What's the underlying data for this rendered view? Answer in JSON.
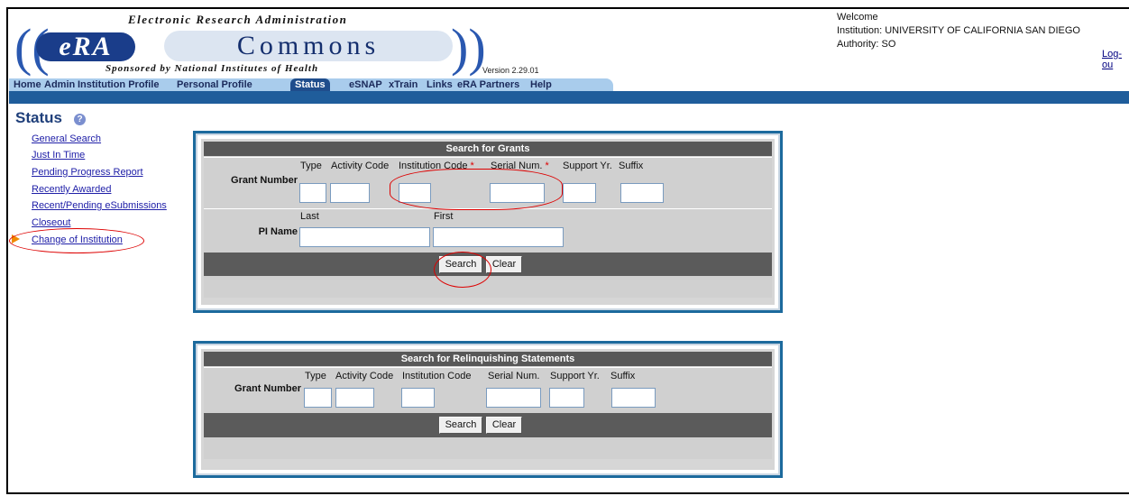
{
  "logo": {
    "top_text": "Electronic Research Administration",
    "era": "eRA",
    "commons": "Commons",
    "bottom_text": "Sponsored by National Institutes of Health"
  },
  "version": "Version 2.29.01",
  "welcome": {
    "line1": "Welcome",
    "institution": "Institution: UNIVERSITY OF CALIFORNIA SAN DIEGO",
    "authority": "Authority:  SO",
    "logout": "Log-ou"
  },
  "nav": {
    "items": [
      "Home",
      "Admin",
      "Institution Profile",
      "Personal Profile",
      "Status",
      "eSNAP",
      "xTrain",
      "Links",
      "eRA Partners",
      "Help"
    ],
    "active": "Status"
  },
  "page_title": "Status",
  "sidebar": {
    "links": [
      "General Search",
      "Just In Time",
      "Pending Progress Report",
      "Recently Awarded",
      "Recent/Pending eSubmissions",
      "Closeout",
      "Change of Institution"
    ]
  },
  "grants_panel": {
    "title": "Search for Grants",
    "grant_number_label": "Grant Number",
    "fields": [
      "Type",
      "Activity Code",
      "Institution Code",
      "Serial Num.",
      "Support Yr.",
      "Suffix"
    ],
    "pi_label": "PI Name",
    "last_label": "Last",
    "first_label": "First",
    "search_button": "Search",
    "clear_button": "Clear"
  },
  "relinquish_panel": {
    "title": "Search for Relinquishing Statements",
    "grant_number_label": "Grant Number",
    "fields": [
      "Type",
      "Activity Code",
      "Institution Code",
      "Serial Num.",
      "Support Yr.",
      "Suffix"
    ],
    "search_button": "Search",
    "clear_button": "Clear"
  },
  "colors": {
    "nav_bar": "#a9ccec",
    "blue_bar": "#1f5d9b",
    "panel_border": "#1c6a9d",
    "panel_header": "#585858",
    "link": "#2020a8",
    "highlight_oval": "#dd0000"
  }
}
